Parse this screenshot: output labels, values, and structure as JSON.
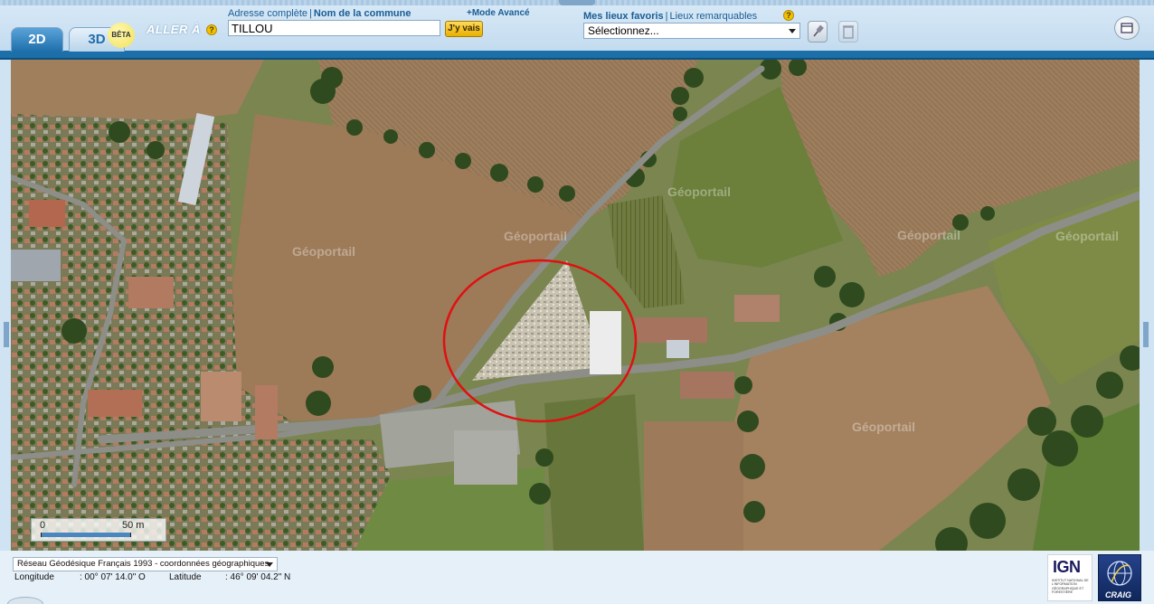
{
  "toolbar": {
    "tab_2d": "2D",
    "tab_3d": "3D",
    "beta": "BÊTA",
    "aller_label": "ALLER À",
    "help": "?",
    "addr_full": "Adresse complète",
    "sep": "|",
    "addr_commune": "Nom de la commune",
    "mode_avance": "+Mode Avancé",
    "search_value": "TILLOU",
    "go_label": "J'y vais",
    "fav_label": "Mes lieux favoris",
    "lieux_remarquables": "Lieux remarquables",
    "fav_select_value": "Sélectionnez..."
  },
  "map": {
    "watermark": "Géoportail",
    "highlight_color": "#e01010",
    "scale_zero": "0",
    "scale_distance": "50 m"
  },
  "footer": {
    "crs": "Réseau Géodésique Français 1993 - coordonnées géographiques",
    "longitude_label": "Longitude",
    "longitude_value": ": 00° 07' 14.0\" O",
    "latitude_label": "Latitude",
    "latitude_value": ": 46° 09' 04.2\" N",
    "ign_logo": "IGN",
    "ign_subtext": "INSTITUT NATIONAL DE L'INFORMATION GÉOGRAPHIQUE ET FORESTIÈRE",
    "craig_logo": "CRAIG"
  },
  "colors": {
    "accent": "#1c6fa9",
    "go_button": "#f0c020"
  }
}
